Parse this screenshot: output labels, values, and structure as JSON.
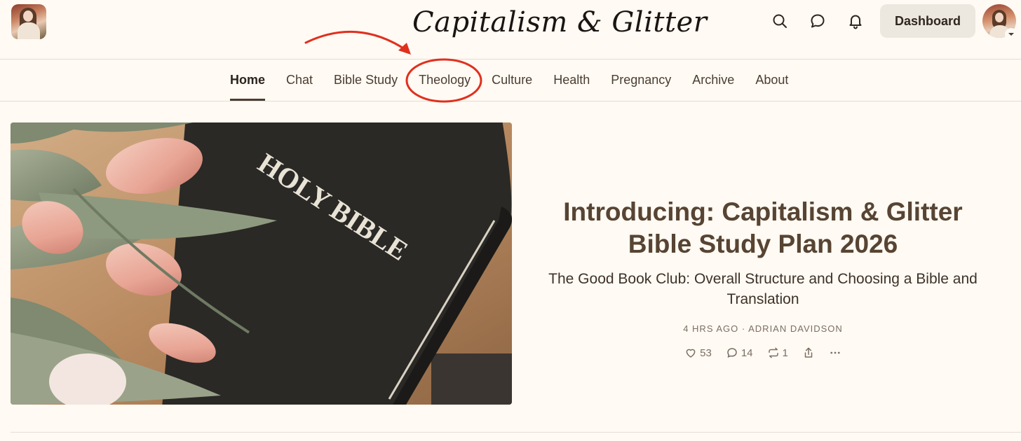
{
  "publication": {
    "title": "Capitalism & Glitter"
  },
  "header": {
    "dashboard_label": "Dashboard",
    "icons": [
      "search-icon",
      "chat-icon",
      "bell-icon"
    ]
  },
  "nav": {
    "tabs": [
      {
        "label": "Home",
        "active": true
      },
      {
        "label": "Chat"
      },
      {
        "label": "Bible Study"
      },
      {
        "label": "Theology"
      },
      {
        "label": "Culture"
      },
      {
        "label": "Health"
      },
      {
        "label": "Pregnancy"
      },
      {
        "label": "Archive"
      },
      {
        "label": "About"
      }
    ]
  },
  "hero": {
    "image_text": "HOLY BIBLE",
    "title_line1": "Introducing: Capitalism & Glitter",
    "title_line2": "Bible Study Plan 2026",
    "subtitle": "The Good Book Club: Overall Structure and Choosing a Bible and Translation",
    "meta": "4 HRS AGO · ADRIAN DAVIDSON",
    "likes": "53",
    "comments": "14",
    "restacks": "1"
  },
  "colors": {
    "background": "#fffaf3",
    "annotation": "#e0301e",
    "title": "#574433"
  }
}
